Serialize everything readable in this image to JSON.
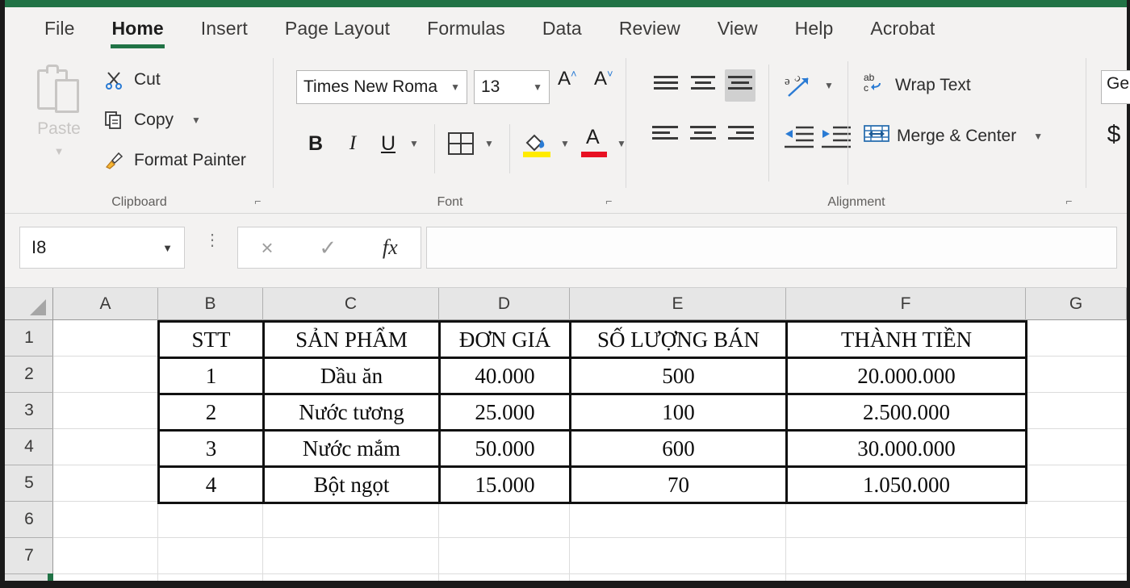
{
  "app": {
    "accent_green": "#217346",
    "ribbon_bg": "#f3f2f1"
  },
  "tabs": [
    {
      "label": "File",
      "active": false
    },
    {
      "label": "Home",
      "active": true
    },
    {
      "label": "Insert",
      "active": false
    },
    {
      "label": "Page Layout",
      "active": false
    },
    {
      "label": "Formulas",
      "active": false
    },
    {
      "label": "Data",
      "active": false
    },
    {
      "label": "Review",
      "active": false
    },
    {
      "label": "View",
      "active": false
    },
    {
      "label": "Help",
      "active": false
    },
    {
      "label": "Acrobat",
      "active": false
    }
  ],
  "ribbon": {
    "clipboard": {
      "group_label": "Clipboard",
      "paste_label": "Paste",
      "cut_label": "Cut",
      "copy_label": "Copy",
      "format_painter_label": "Format Painter"
    },
    "font": {
      "group_label": "Font",
      "font_name": "Times New Roma",
      "font_size": "13",
      "grow_label": "A",
      "shrink_label": "A",
      "bold_label": "B",
      "italic_label": "I",
      "underline_label": "U",
      "fill_color": "#ffeb00",
      "font_color": "#e81123"
    },
    "alignment": {
      "group_label": "Alignment",
      "wrap_text_label": "Wrap Text",
      "merge_center_label": "Merge & Center",
      "selected_vertical_align": "bottom"
    },
    "number": {
      "format_value": "Gen",
      "currency_label": "$"
    }
  },
  "formula_bar": {
    "name_box_value": "I8",
    "cancel_icon": "×",
    "enter_icon": "✓",
    "function_icon": "fx",
    "formula_value": ""
  },
  "grid": {
    "columns": [
      "A",
      "B",
      "C",
      "D",
      "E",
      "F",
      "G"
    ],
    "rows": [
      "1",
      "2",
      "3",
      "4",
      "5",
      "6",
      "7"
    ]
  },
  "table": {
    "headers": [
      "STT",
      "SẢN PHẨM",
      "ĐƠN GIÁ",
      "SỐ LƯỢNG BÁN",
      "THÀNH TIỀN"
    ],
    "rows": [
      [
        "1",
        "Dầu ăn",
        "40.000",
        "500",
        "20.000.000"
      ],
      [
        "2",
        "Nước tương",
        "25.000",
        "100",
        "2.500.000"
      ],
      [
        "3",
        "Nước mắm",
        "50.000",
        "600",
        "30.000.000"
      ],
      [
        "4",
        "Bột ngọt",
        "15.000",
        "70",
        "1.050.000"
      ]
    ]
  }
}
